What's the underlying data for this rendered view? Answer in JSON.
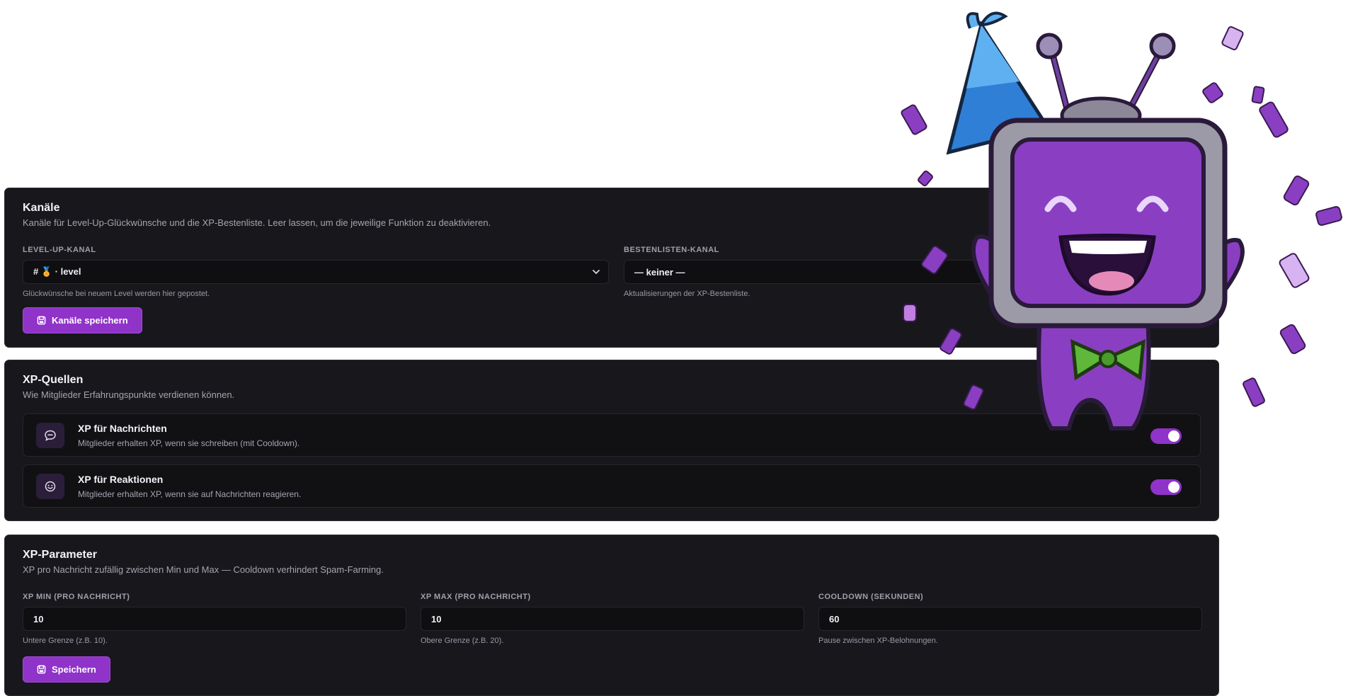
{
  "channels": {
    "title": "Kanäle",
    "description": "Kanäle für Level-Up-Glückwünsche und die XP-Bestenliste. Leer lassen, um die jeweilige Funktion zu deaktivieren.",
    "levelup": {
      "label": "LEVEL-UP-KANAL",
      "value": "# 🏅 · level",
      "hint": "Glückwünsche bei neuem Level werden hier gepostet."
    },
    "leaderboard": {
      "label": "BESTENLISTEN-KANAL",
      "value": "— keiner —",
      "hint": "Aktualisierungen der XP-Bestenliste."
    },
    "save_label": "Kanäle speichern"
  },
  "sources": {
    "title": "XP-Quellen",
    "description": "Wie Mitglieder Erfahrungspunkte verdienen können.",
    "items": [
      {
        "title": "XP für Nachrichten",
        "description": "Mitglieder erhalten XP, wenn sie schreiben (mit Cooldown).",
        "icon": "message-bubble-icon",
        "enabled": true
      },
      {
        "title": "XP für Reaktionen",
        "description": "Mitglieder erhalten XP, wenn sie auf Nachrichten reagieren.",
        "icon": "smiley-icon",
        "enabled": true
      }
    ]
  },
  "params": {
    "title": "XP-Parameter",
    "description": "XP pro Nachricht zufällig zwischen Min und Max — Cooldown verhindert Spam-Farming.",
    "fields": [
      {
        "label": "XP MIN (PRO NACHRICHT)",
        "value": "10",
        "hint": "Untere Grenze (z.B. 10)."
      },
      {
        "label": "XP MAX (PRO NACHRICHT)",
        "value": "10",
        "hint": "Obere Grenze (z.B. 20)."
      },
      {
        "label": "COOLDOWN (SEKUNDEN)",
        "value": "60",
        "hint": "Pause zwischen XP-Belohnungen."
      }
    ],
    "save_label": "Speichern"
  },
  "colors": {
    "accent": "#8f33c9",
    "card_bg": "#18181c",
    "input_bg": "#0f0f12"
  },
  "decor": {
    "mascot": "party-tv-robot-mascot"
  }
}
